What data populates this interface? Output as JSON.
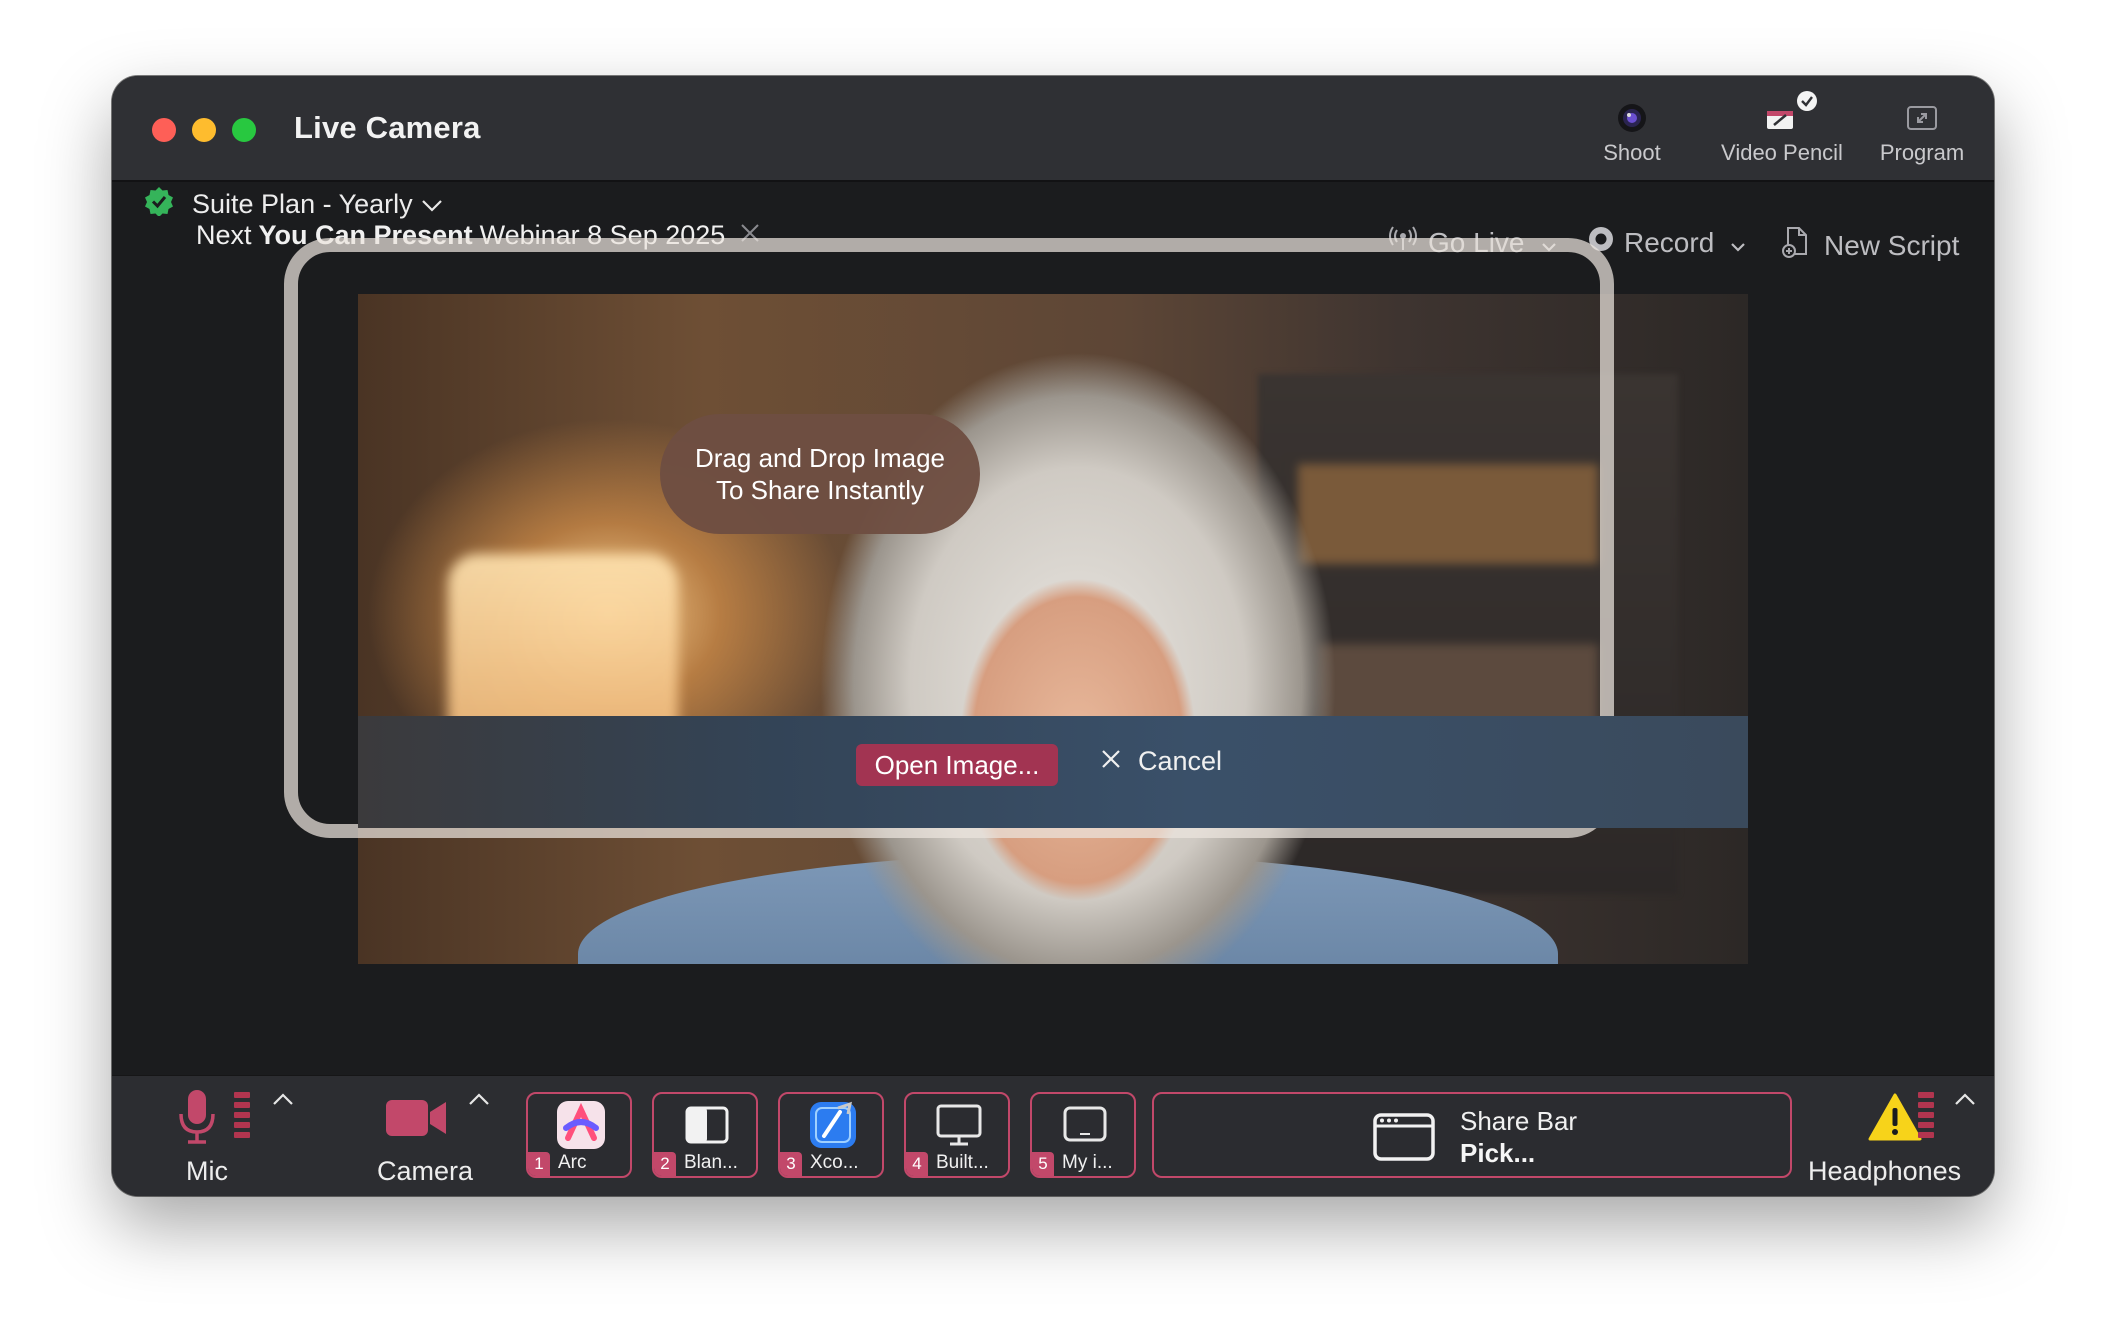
{
  "window": {
    "title": "Live Camera"
  },
  "titlebar": {
    "shoot_label": "Shoot",
    "video_pencil_label": "Video Pencil",
    "program_label": "Program"
  },
  "plan": {
    "name": "Suite Plan - Yearly",
    "next_prefix": "Next",
    "next_event": "You Can Present",
    "next_suffix": "Webinar 8 Sep 2025"
  },
  "actions": {
    "go_live": "Go Live",
    "record": "Record",
    "new_script": "New Script"
  },
  "preview": {
    "drop_line1": "Drag and Drop Image",
    "drop_line2": "To Share Instantly",
    "open_image": "Open Image...",
    "cancel": "Cancel"
  },
  "bottom": {
    "mic_label": "Mic",
    "camera_label": "Camera",
    "headphones_label": "Headphones",
    "apps": [
      {
        "num": "1",
        "name": "Arc",
        "icon": "arc-app-icon"
      },
      {
        "num": "2",
        "name": "Blan...",
        "icon": "blank-window-icon"
      },
      {
        "num": "3",
        "name": "Xco...",
        "icon": "xcode-app-icon"
      },
      {
        "num": "4",
        "name": "Built...",
        "icon": "monitor-icon"
      },
      {
        "num": "5",
        "name": "My i...",
        "icon": "tablet-icon"
      }
    ],
    "share_bar_title": "Share Bar",
    "share_bar_action": "Pick..."
  },
  "colors": {
    "accent": "#c2486a",
    "accent_dark": "#a23452",
    "window_bg": "#1b1c1e",
    "titlebar_bg": "#2f3034",
    "ok_green": "#35b45a",
    "warning_yellow": "#f7d31a"
  }
}
